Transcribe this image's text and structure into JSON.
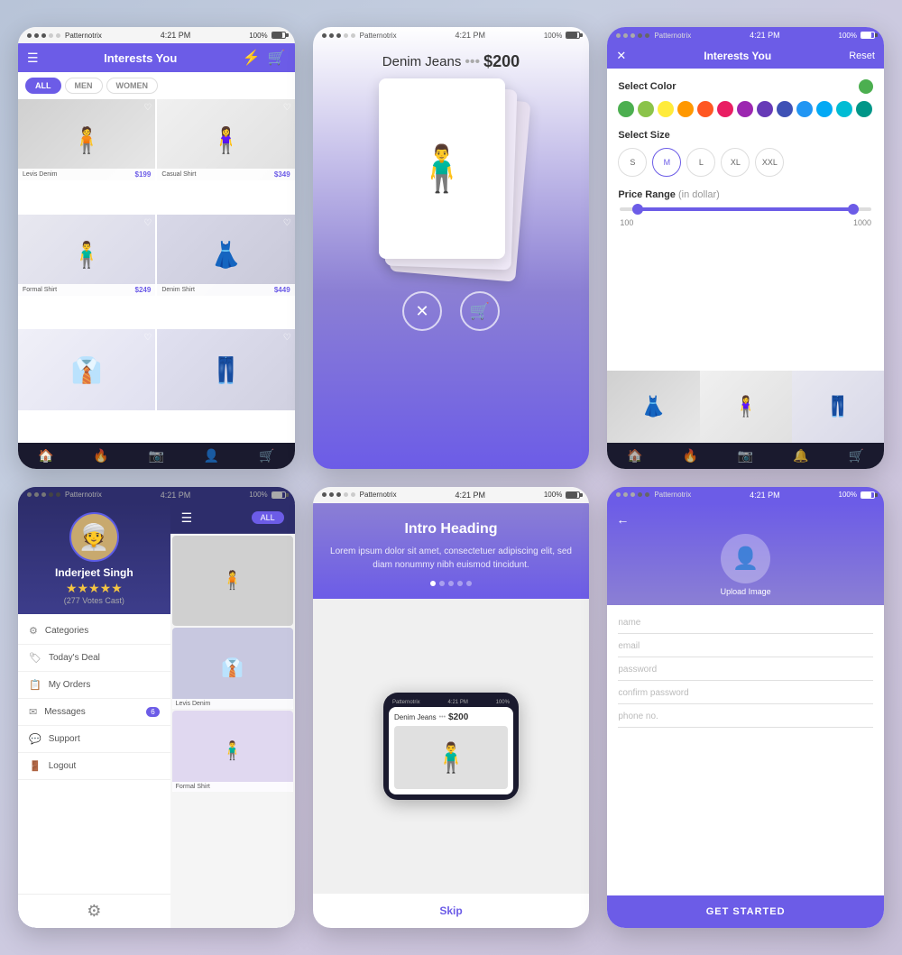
{
  "app": {
    "status_time": "4:21 PM",
    "status_carrier": "Patternotrix",
    "status_battery": "100%"
  },
  "phone1": {
    "title": "Interests You",
    "filter_tabs": [
      "ALL",
      "MEN",
      "WOMEN"
    ],
    "active_tab": "ALL",
    "products": [
      {
        "name": "Levis Denim",
        "price": "$199"
      },
      {
        "name": "Casual Shirt",
        "price": "$349"
      },
      {
        "name": "Formal Shirt",
        "price": "$249"
      },
      {
        "name": "Denim Shirt",
        "price": "$449"
      }
    ],
    "nav_items": [
      "🏠",
      "🔥",
      "📷",
      "👤",
      "🛒"
    ]
  },
  "phone2": {
    "product_name": "Denim Jeans",
    "product_dots": "•••",
    "product_price": "$200",
    "action_close": "✕",
    "action_cart": "🛒"
  },
  "phone3": {
    "title": "Interests You",
    "reset_label": "Reset",
    "close_icon": "✕",
    "select_color_label": "Select Color",
    "colors": [
      "#4CAF50",
      "#8BC34A",
      "#FFEB3B",
      "#FF9800",
      "#FF5722",
      "#E91E63",
      "#9C27B0",
      "#673AB7",
      "#3F51B5",
      "#2196F3",
      "#03A9F4",
      "#00BCD4",
      "#009688"
    ],
    "selected_color": "#4CAF50",
    "select_size_label": "Select Size",
    "sizes": [
      "S",
      "M",
      "L",
      "XL",
      "XXL"
    ],
    "selected_size": "M",
    "price_range_label": "Price Range",
    "price_range_unit": "(in dollar)",
    "price_min": "100",
    "price_max": "1000"
  },
  "phone4": {
    "profile_name": "Inderjeet Singh",
    "votes": "(277 Votes Cast)",
    "stars": "★★★★★",
    "menu_items": [
      {
        "icon": "⚙",
        "label": "Categories"
      },
      {
        "icon": "🏷",
        "label": "Today's Deal"
      },
      {
        "icon": "📋",
        "label": "My Orders"
      },
      {
        "icon": "✉",
        "label": "Messages",
        "badge": "6"
      },
      {
        "icon": "💬",
        "label": "Support"
      },
      {
        "icon": "🚪",
        "label": "Logout"
      }
    ],
    "all_label": "ALL"
  },
  "phone5": {
    "intro_heading": "Intro Heading",
    "intro_body": "Lorem ipsum dolor sit amet, consectetuer adipiscing elit, sed diam nonummy nibh euismod tincidunt.",
    "dots": [
      true,
      false,
      false,
      false,
      false
    ],
    "inner_product": "Denim Jeans",
    "inner_dots": "•••",
    "inner_price": "$200",
    "skip_label": "Skip"
  },
  "phone6": {
    "upload_label": "Upload Image",
    "form_fields": [
      {
        "placeholder": "name"
      },
      {
        "placeholder": "email"
      },
      {
        "placeholder": "password"
      },
      {
        "placeholder": "confirm password"
      },
      {
        "placeholder": "phone no."
      }
    ],
    "cta_label": "GET STARTED"
  }
}
